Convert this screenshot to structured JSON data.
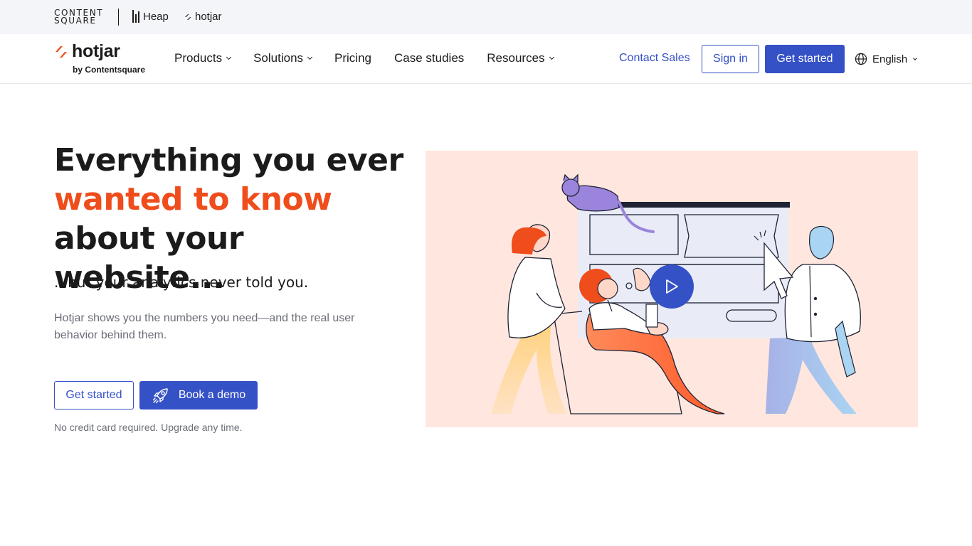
{
  "brand_bar": {
    "contentsquare_line1": "CONTENT",
    "contentsquare_line2": "SQUARE",
    "heap": "Heap",
    "hotjar": "hotjar"
  },
  "nav": {
    "logo_word": "hotjar",
    "logo_by": "by Contentsquare",
    "links": [
      {
        "label": "Products",
        "has_dropdown": true
      },
      {
        "label": "Solutions",
        "has_dropdown": true
      },
      {
        "label": "Pricing",
        "has_dropdown": false
      },
      {
        "label": "Case studies",
        "has_dropdown": false
      },
      {
        "label": "Resources",
        "has_dropdown": true
      }
    ],
    "contact_sales": "Contact Sales",
    "sign_in": "Sign in",
    "get_started": "Get started",
    "language": "English"
  },
  "hero": {
    "title_part1": "Everything you ever",
    "title_accent": "wanted to know",
    "title_part2": "about your website...",
    "subtitle": "...but your analytics never told you.",
    "description": "Hotjar shows you the numbers you need—and the real user behavior behind them.",
    "cta_primary": "Get started",
    "cta_secondary": "Book a demo",
    "note": "No credit card required. Upgrade any time."
  },
  "colors": {
    "accent": "#ef4d1c",
    "brand_blue": "#3551c6",
    "illustration_bg": "#ffe7df"
  },
  "icons": {
    "language": "globe-icon",
    "demo": "rocket-icon",
    "video": "play-icon"
  }
}
